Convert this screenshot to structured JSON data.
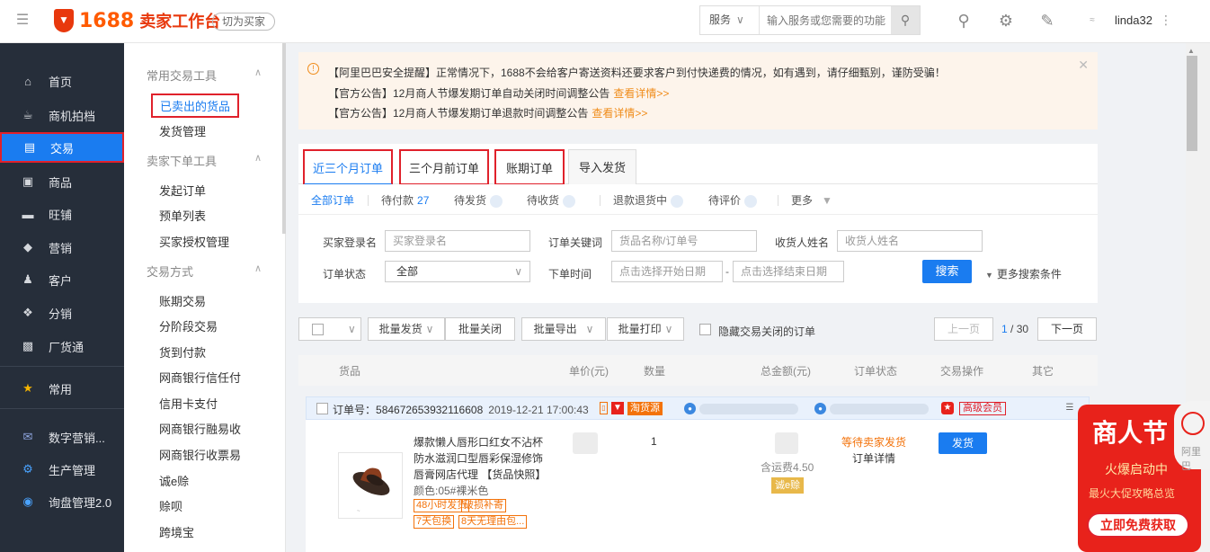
{
  "topbar": {
    "brand_num": "1688",
    "brand_name": "卖家工作台",
    "switch_label": "切为买家",
    "search_service": "服务",
    "search_placeholder": "输入服务或您需要的功能",
    "username": "linda32"
  },
  "sidebar": {
    "items": [
      {
        "label": "首页",
        "icon": "home-icon"
      },
      {
        "label": "商机拍档",
        "icon": "teapot-icon"
      },
      {
        "label": "交易",
        "icon": "clipboard-icon"
      },
      {
        "label": "商品",
        "icon": "box-icon"
      },
      {
        "label": "旺铺",
        "icon": "shop-icon"
      },
      {
        "label": "营销",
        "icon": "tag-icon"
      },
      {
        "label": "客户",
        "icon": "person-icon"
      },
      {
        "label": "分销",
        "icon": "distribute-icon"
      },
      {
        "label": "厂货通",
        "icon": "factory-icon"
      },
      {
        "label": "常用",
        "icon": "star-icon"
      },
      {
        "label": "数字营销...",
        "icon": "mail-icon"
      },
      {
        "label": "生产管理",
        "icon": "gear-box-icon"
      },
      {
        "label": "询盘管理2.0",
        "icon": "inquiry-icon"
      }
    ],
    "active_color": "#1a7cf0"
  },
  "subnav": {
    "groups": [
      {
        "title": "常用交易工具",
        "links": [
          "已卖出的货品",
          "发货管理"
        ]
      },
      {
        "title": "卖家下单工具",
        "links": [
          "发起订单",
          "预单列表",
          "买家授权管理"
        ]
      },
      {
        "title": "交易方式",
        "links": [
          "账期交易",
          "分阶段交易",
          "货到付款",
          "网商银行信任付",
          "信用卡支付",
          "网商银行融易收",
          "网商银行收票易",
          "诚e赊",
          "赊呗",
          "跨境宝"
        ]
      }
    ]
  },
  "notice": {
    "lines": [
      {
        "text": "【阿里巴巴安全提醒】正常情况下，1688不会给客户寄送资料还要求客户到付快递费的情况，如有遇到，请仔细甄别，谨防受骗！",
        "more": ""
      },
      {
        "text": "【官方公告】12月商人节爆发期订单自动关闭时间调整公告",
        "more": "查看详情>>"
      },
      {
        "text": "【官方公告】12月商人节爆发期订单退款时间调整公告",
        "more": "查看详情>>"
      }
    ]
  },
  "tabs": [
    "近三个月订单",
    "三个月前订单",
    "账期订单",
    "导入发货"
  ],
  "status_tabs": {
    "all": "全部订单",
    "pending_pay": "待付款",
    "pending_pay_count": "27",
    "pending_ship": "待发货",
    "pending_receive": "待收货",
    "refund": "退款退货中",
    "pending_review": "待评价",
    "more": "更多"
  },
  "filter": {
    "buyer_label": "买家登录名",
    "buyer_placeholder": "买家登录名",
    "keyword_label": "订单关键词",
    "keyword_placeholder": "货品名称/订单号",
    "receiver_label": "收货人姓名",
    "receiver_placeholder": "收货人姓名",
    "status_label": "订单状态",
    "status_value": "全部",
    "time_label": "下单时间",
    "start_placeholder": "点击选择开始日期",
    "end_placeholder": "点击选择结束日期",
    "search_label": "搜索",
    "more_label": "更多搜索条件"
  },
  "toolbar": {
    "batch_ship": "批量发货",
    "batch_close": "批量关闭",
    "batch_export": "批量导出",
    "batch_print": "批量打印",
    "hide_closed": "隐藏交易关闭的订单",
    "prev": "上一页",
    "page_current": "1",
    "page_total": "/ 30",
    "next": "下一页"
  },
  "table_headers": [
    "货品",
    "单价(元)",
    "数量",
    "总金额(元)",
    "订单状态",
    "交易操作",
    "其它"
  ],
  "order": {
    "order_no_label": "订单号：",
    "order_no": "584672653932116608",
    "time": "2019-12-21 17:00:43",
    "source_tag": "淘货源",
    "vip_tag": "高级会员",
    "product_title": "爆款懒人唇形口红女不沾杯防水滋润口型唇彩保湿修饰唇膏网店代理 【货品快照】",
    "product_spec": "颜色:05#裸米色",
    "product_tags": [
      "48小时发货",
      "破损补寄",
      "7天包换",
      "8天无理由包..."
    ],
    "quantity": "1",
    "shipping_fee": "含运费4.50",
    "credit_tag": "诚e赊",
    "status": "等待卖家发货",
    "detail_link": "订单详情",
    "ship_button": "发货"
  },
  "promo": {
    "title": "商人节",
    "subtitle": "火爆启动中",
    "slogan": "最火大促攻略总览",
    "button": "立即免费获取",
    "mascot_text": "阿里巴"
  }
}
